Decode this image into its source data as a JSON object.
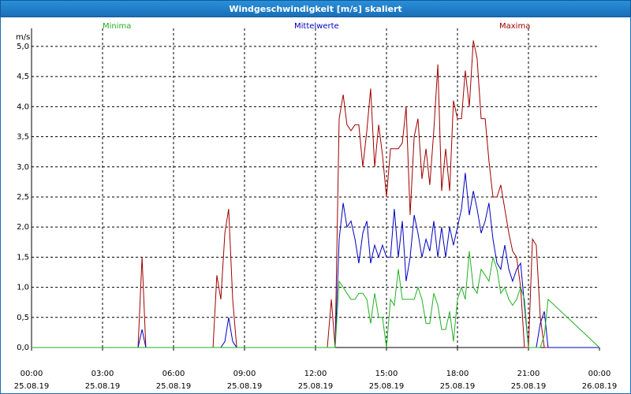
{
  "window": {
    "title": "Windgeschwindigkeit [m/s] skaliert"
  },
  "colors": {
    "minima": "#22b022",
    "mittelwerte": "#0000c0",
    "maxima": "#a00000",
    "grid": "#000000",
    "axis": "#000000"
  },
  "chart_data": {
    "type": "line",
    "title": "Windgeschwindigkeit [m/s] skaliert",
    "ylabel": "m/s",
    "xlabel": "",
    "ylim": [
      0,
      5.3
    ],
    "xlim": [
      0,
      24
    ],
    "grid": true,
    "legend": "top",
    "yticks": [
      "0,0",
      "0,5",
      "1,0",
      "1,5",
      "2,0",
      "2,5",
      "3,0",
      "3,5",
      "4,0",
      "4,5",
      "5,0"
    ],
    "xticks": [
      {
        "time": "00:00",
        "date": "25.08.19"
      },
      {
        "time": "03:00",
        "date": "25.08.19"
      },
      {
        "time": "06:00",
        "date": "25.08.19"
      },
      {
        "time": "09:00",
        "date": "25.08.19"
      },
      {
        "time": "12:00",
        "date": "25.08.19"
      },
      {
        "time": "15:00",
        "date": "25.08.19"
      },
      {
        "time": "18:00",
        "date": "25.08.19"
      },
      {
        "time": "21:00",
        "date": "25.08.19"
      },
      {
        "time": "00:00",
        "date": "26.08.19"
      }
    ],
    "series": [
      {
        "name": "Maxima",
        "x": [
          0,
          4.5,
          4.67,
          4.83,
          7.67,
          7.83,
          8.0,
          8.17,
          8.33,
          8.5,
          8.67,
          12.5,
          12.67,
          12.83,
          13.0,
          13.17,
          13.33,
          13.5,
          13.67,
          13.83,
          14.0,
          14.17,
          14.33,
          14.5,
          14.67,
          14.83,
          15.0,
          15.17,
          15.33,
          15.5,
          15.67,
          15.83,
          16.0,
          16.17,
          16.33,
          16.5,
          16.67,
          16.83,
          17.0,
          17.17,
          17.33,
          17.5,
          17.67,
          17.83,
          18.0,
          18.17,
          18.33,
          18.5,
          18.67,
          18.83,
          19.0,
          19.17,
          19.33,
          19.5,
          19.67,
          19.83,
          20.0,
          20.17,
          20.33,
          20.5,
          20.67,
          20.83,
          21.0,
          21.17,
          21.33,
          21.5,
          21.67,
          21.83,
          22.0,
          24
        ],
        "y": [
          0,
          0,
          1.5,
          0,
          0,
          1.2,
          0.8,
          1.9,
          2.3,
          0.8,
          0,
          0,
          0.8,
          0,
          3.8,
          4.2,
          3.7,
          3.6,
          3.7,
          3.7,
          3.0,
          3.6,
          4.3,
          3.0,
          3.7,
          3.2,
          2.5,
          3.3,
          3.3,
          3.3,
          3.4,
          4.0,
          2.2,
          3.5,
          3.8,
          2.8,
          3.3,
          2.7,
          3.6,
          4.7,
          2.6,
          3.3,
          2.6,
          4.1,
          3.8,
          3.8,
          4.6,
          4.0,
          5.1,
          4.8,
          3.8,
          3.8,
          3.1,
          2.5,
          2.5,
          2.7,
          2.3,
          1.9,
          1.6,
          1.5,
          1.0,
          0,
          0,
          1.8,
          1.7,
          0.5,
          0,
          0,
          0,
          0
        ]
      },
      {
        "name": "Mittelwerte",
        "x": [
          0,
          4.5,
          4.67,
          4.83,
          8.0,
          8.17,
          8.33,
          8.5,
          8.67,
          12.83,
          13.0,
          13.17,
          13.33,
          13.5,
          13.67,
          13.83,
          14.0,
          14.17,
          14.33,
          14.5,
          14.67,
          14.83,
          15.0,
          15.17,
          15.33,
          15.5,
          15.67,
          15.83,
          16.0,
          16.17,
          16.33,
          16.5,
          16.67,
          16.83,
          17.0,
          17.17,
          17.33,
          17.5,
          17.67,
          17.83,
          18.0,
          18.17,
          18.33,
          18.5,
          18.67,
          18.83,
          19.0,
          19.17,
          19.33,
          19.5,
          19.67,
          19.83,
          20.0,
          20.17,
          20.33,
          20.5,
          20.67,
          20.83,
          21.0,
          21.33,
          21.5,
          21.67,
          21.83,
          24
        ],
        "y": [
          0,
          0,
          0.3,
          0,
          0,
          0.1,
          0.5,
          0.1,
          0,
          0,
          1.8,
          2.4,
          2.0,
          2.1,
          1.8,
          1.4,
          1.9,
          2.1,
          1.4,
          1.7,
          1.5,
          1.7,
          1.5,
          1.5,
          2.3,
          1.5,
          2.1,
          1.1,
          1.5,
          2.2,
          1.9,
          1.5,
          1.8,
          1.6,
          2.1,
          1.5,
          2.0,
          1.5,
          2.0,
          1.7,
          2.0,
          2.3,
          2.9,
          2.2,
          2.6,
          2.3,
          1.9,
          2.1,
          2.4,
          1.8,
          1.4,
          1.3,
          1.7,
          1.3,
          1.1,
          1.3,
          1.4,
          0.7,
          0,
          0,
          0.4,
          0.6,
          0,
          0
        ]
      },
      {
        "name": "Minima",
        "x": [
          0,
          12.83,
          13.0,
          13.17,
          13.33,
          13.5,
          13.67,
          13.83,
          14.0,
          14.17,
          14.33,
          14.5,
          14.67,
          14.83,
          15.0,
          15.17,
          15.33,
          15.5,
          15.67,
          15.83,
          16.0,
          16.17,
          16.33,
          16.5,
          16.67,
          16.83,
          17.0,
          17.17,
          17.33,
          17.5,
          17.67,
          17.83,
          18.0,
          18.17,
          18.33,
          18.5,
          18.67,
          18.83,
          19.0,
          19.17,
          19.33,
          19.5,
          19.67,
          19.83,
          20.0,
          20.17,
          20.33,
          20.5,
          20.67,
          20.83,
          21.0,
          21.5,
          21.67,
          21.83,
          24
        ],
        "y": [
          0,
          0,
          1.1,
          1.0,
          0.9,
          0.8,
          0.8,
          0.9,
          0.9,
          0.8,
          0.4,
          0.9,
          0.5,
          0.5,
          0.0,
          0.8,
          0.7,
          1.3,
          0.8,
          0.8,
          0.8,
          0.8,
          1.0,
          0.8,
          0.4,
          0.4,
          0.9,
          0.7,
          0.3,
          0.3,
          0.6,
          0.1,
          0.8,
          1.0,
          0.8,
          1.6,
          1.0,
          0.9,
          1.3,
          1.2,
          1.1,
          1.5,
          1.3,
          0.9,
          1.0,
          0.8,
          0.7,
          0.8,
          1.0,
          0.8,
          0,
          0,
          0.2,
          0.8,
          0
        ]
      }
    ]
  }
}
